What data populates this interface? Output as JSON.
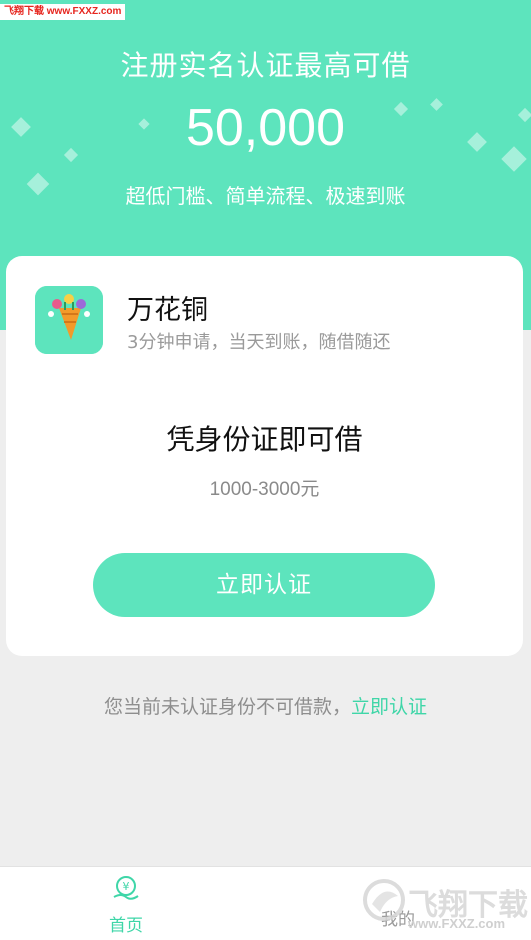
{
  "watermark": {
    "top_text": "飞翔下载 www.FXXZ.com",
    "bottom_title": "飞翔下载",
    "bottom_url": "www.FXXZ.com"
  },
  "hero": {
    "title": "注册实名认证最高可借",
    "amount": "50,000",
    "subtitle": "超低门槛、简单流程、极速到账"
  },
  "card": {
    "app_icon": "carrot-bouquet-icon",
    "app_name": "万花铜",
    "app_desc": "3分钟申请，当天到账，随借随还",
    "headline": "凭身份证即可借",
    "range": "1000-3000元",
    "cta_label": "立即认证"
  },
  "notice": {
    "text": "您当前未认证身份不可借款，",
    "link": "立即认证"
  },
  "tabbar": {
    "home_icon": "yen-hand-icon",
    "home_label": "首页",
    "mine_label": "我的"
  },
  "colors": {
    "accent": "#5de4bd",
    "link": "#3fd6a8",
    "background": "#eeeeee"
  }
}
